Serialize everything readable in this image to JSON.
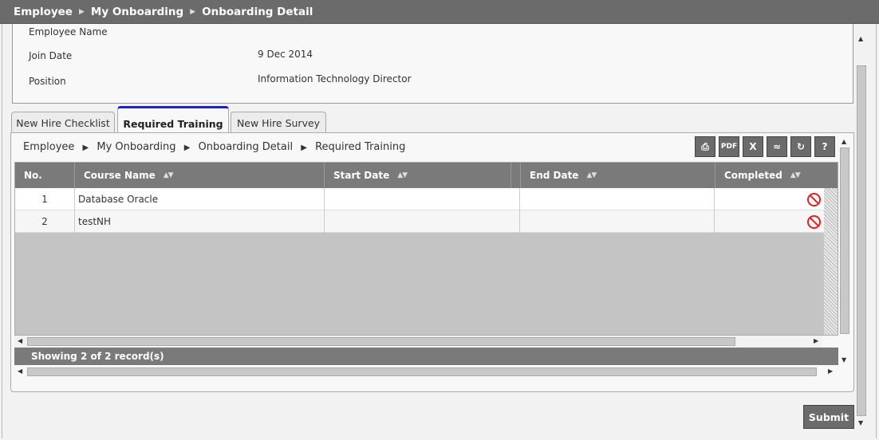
{
  "topbar": {
    "crumbs": [
      "Employee",
      "My Onboarding",
      "Onboarding Detail"
    ]
  },
  "employee_info": {
    "rows": [
      {
        "label": "Employee Name",
        "value": ""
      },
      {
        "label": "Join Date",
        "value": "9 Dec 2014"
      },
      {
        "label": "Position",
        "value": "Information Technology Director"
      }
    ]
  },
  "tabs": [
    {
      "label": "New Hire Checklist",
      "active": false
    },
    {
      "label": "Required Training",
      "active": true
    },
    {
      "label": "New Hire Survey",
      "active": false
    }
  ],
  "inner_breadcrumb": [
    "Employee",
    "My Onboarding",
    "Onboarding Detail",
    "Required Training"
  ],
  "toolbar": {
    "buttons": [
      {
        "name": "print-icon",
        "label": "⎙"
      },
      {
        "name": "pdf-icon",
        "label": "PDF"
      },
      {
        "name": "excel-icon",
        "label": "X"
      },
      {
        "name": "wrap-icon",
        "label": "≈"
      },
      {
        "name": "refresh-icon",
        "label": "↻"
      },
      {
        "name": "help-icon",
        "label": "?"
      }
    ]
  },
  "grid": {
    "columns": [
      "No.",
      "Course Name",
      "Start Date",
      "End Date",
      "Completed"
    ],
    "rows": [
      {
        "no": "1",
        "course": "Database Oracle",
        "start": "",
        "end": "",
        "completed": "not-completed-icon"
      },
      {
        "no": "2",
        "course": "testNH",
        "start": "",
        "end": "",
        "completed": "not-completed-icon"
      }
    ],
    "footer": "Showing 2 of 2 record(s)"
  },
  "submit_label": "Submit",
  "colors": {
    "active_tab_border": "#1a1aff",
    "not_completed": "#e02020",
    "header_bg": "#6b6b6b"
  }
}
